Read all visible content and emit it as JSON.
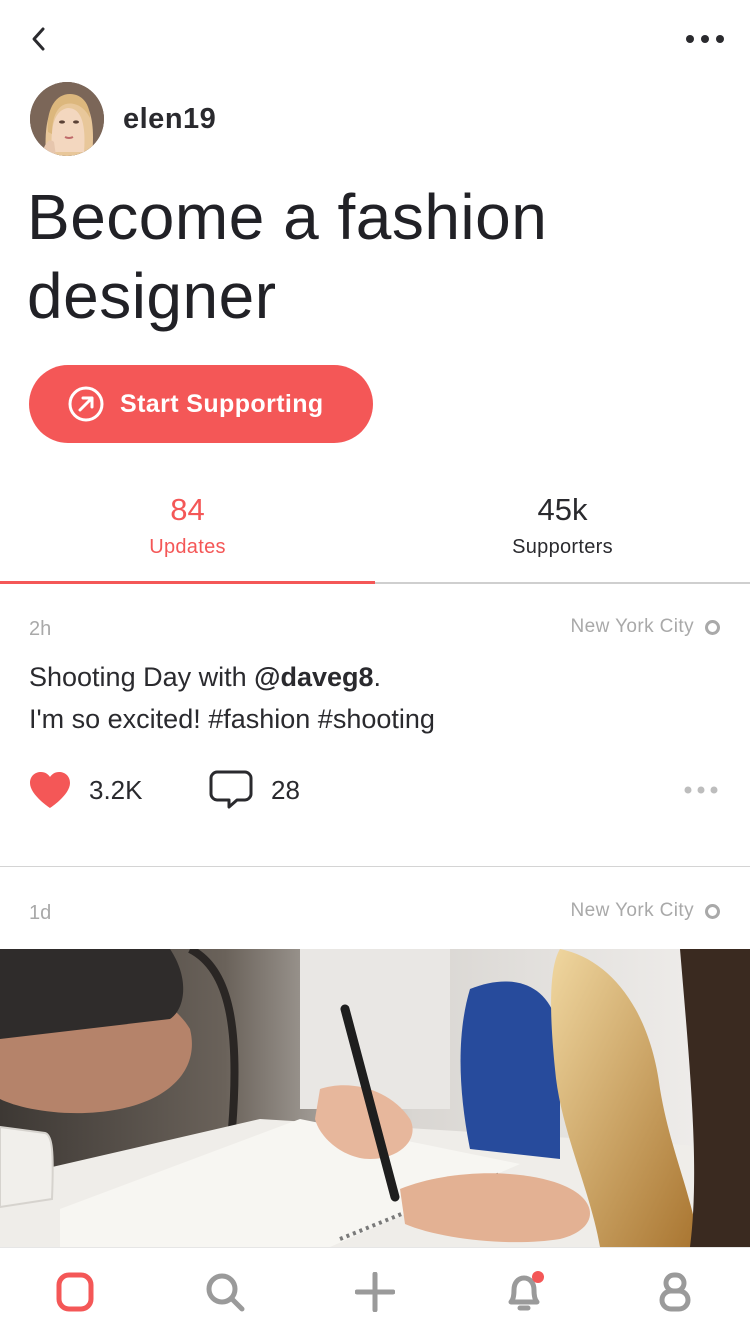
{
  "header": {
    "back_icon": "chevron-left-icon",
    "more_icon": "more-horizontal-icon"
  },
  "profile": {
    "username": "elen19"
  },
  "title": "Become a fashion designer",
  "cta": {
    "label": "Start Supporting",
    "icon": "arrow-up-right-circle-icon"
  },
  "stats": [
    {
      "value": "84",
      "label": "Updates",
      "active": true
    },
    {
      "value": "45k",
      "label": "Supporters",
      "active": false
    }
  ],
  "posts": [
    {
      "time": "2h",
      "location": "New York City",
      "text_prefix": "Shooting Day with ",
      "mention": "@daveg8",
      "text_suffix": ".",
      "text_line2": "I'm so excited! #fashion #shooting",
      "likes": "3.2K",
      "comments": "28"
    },
    {
      "time": "1d",
      "location": "New York City"
    }
  ],
  "tabbar": {
    "items": [
      "home-icon",
      "search-icon",
      "add-icon",
      "bell-icon",
      "profile-icon"
    ],
    "notification_dot": true
  },
  "colors": {
    "accent": "#f45757",
    "text": "#2a2a2e",
    "muted": "#a9a9a9",
    "icon_gray": "#9a9a9a"
  }
}
